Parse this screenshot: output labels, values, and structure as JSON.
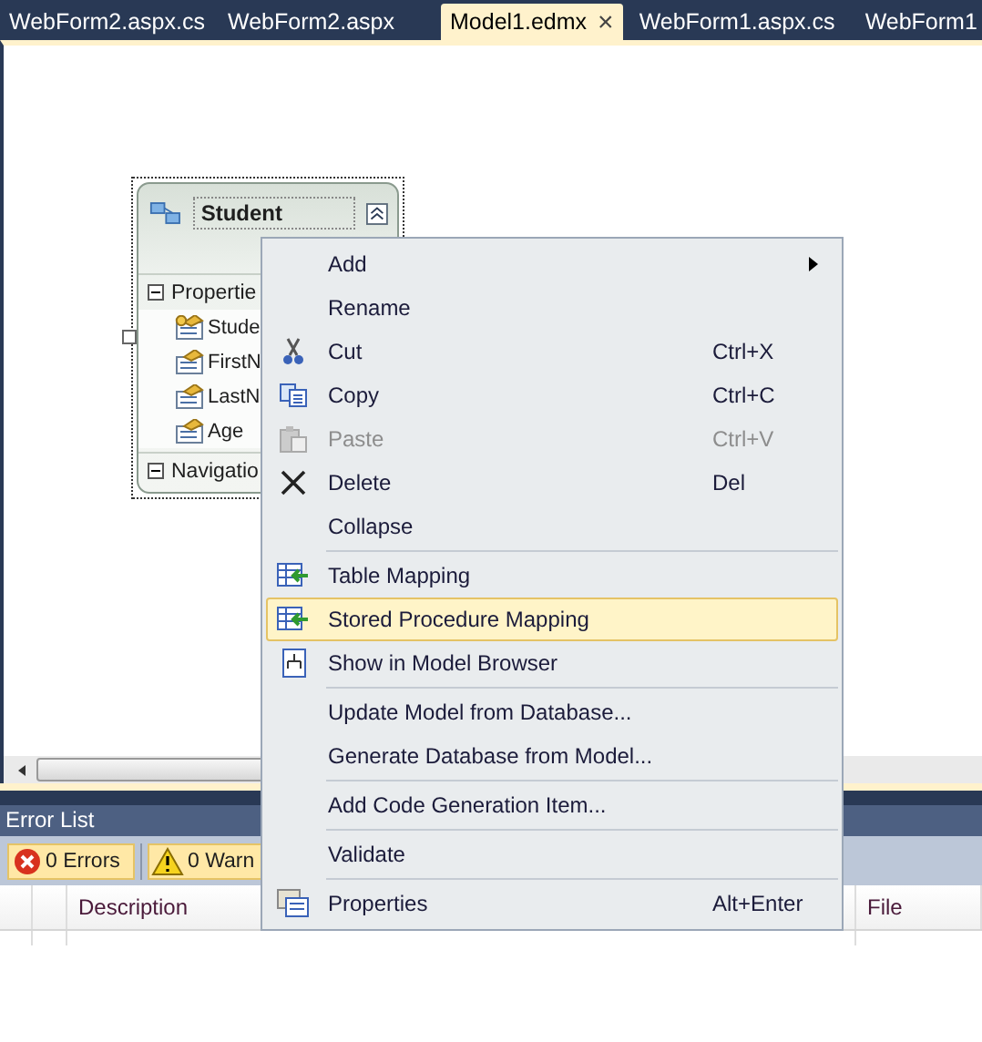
{
  "tabs": [
    {
      "label": "WebForm2.aspx.cs",
      "selected": false
    },
    {
      "label": "WebForm2.aspx",
      "selected": false
    },
    {
      "label": "Model1.edmx",
      "selected": true,
      "close": "×"
    },
    {
      "label": "WebForm1.aspx.cs",
      "selected": false
    },
    {
      "label": "WebForm1",
      "selected": false
    }
  ],
  "entity": {
    "title": "Student",
    "sections": [
      {
        "label": "Propertie",
        "children": [
          {
            "label": "Stude",
            "key": true
          },
          {
            "label": "FirstN",
            "key": false
          },
          {
            "label": "LastN",
            "key": false
          },
          {
            "label": "Age",
            "key": false
          }
        ]
      },
      {
        "label": "Navigatio"
      }
    ]
  },
  "context_menu": {
    "groups": [
      [
        {
          "label": "Add",
          "submenu": true,
          "disabled": false,
          "selected": false
        },
        {
          "label": "Rename",
          "disabled": false,
          "selected": false
        },
        {
          "label": "Cut",
          "shortcut": "Ctrl+X",
          "disabled": false,
          "selected": false
        },
        {
          "label": "Copy",
          "shortcut": "Ctrl+C",
          "disabled": false,
          "selected": false
        },
        {
          "label": "Paste",
          "shortcut": "Ctrl+V",
          "disabled": true,
          "selected": false
        },
        {
          "label": "Delete",
          "shortcut": "Del",
          "disabled": false,
          "selected": false
        },
        {
          "label": "Collapse",
          "disabled": false,
          "selected": false
        }
      ],
      [
        {
          "label": "Table Mapping",
          "disabled": false,
          "selected": false
        },
        {
          "label": "Stored Procedure Mapping",
          "disabled": false,
          "selected": true
        },
        {
          "label": "Show in Model Browser",
          "disabled": false,
          "selected": false
        }
      ],
      [
        {
          "label": "Update Model from Database...",
          "disabled": false,
          "selected": false
        },
        {
          "label": "Generate Database from Model...",
          "disabled": false,
          "selected": false
        }
      ],
      [
        {
          "label": "Add Code Generation Item...",
          "disabled": false,
          "selected": false
        }
      ],
      [
        {
          "label": "Validate",
          "disabled": false,
          "selected": false
        }
      ],
      [
        {
          "label": "Properties",
          "shortcut": "Alt+Enter",
          "disabled": false,
          "selected": false
        }
      ]
    ]
  },
  "error_list": {
    "title": "Error List",
    "buttons": [
      {
        "label": "0 Errors"
      },
      {
        "label": "0 Warn"
      }
    ],
    "columns": [
      "Description",
      "File"
    ]
  }
}
